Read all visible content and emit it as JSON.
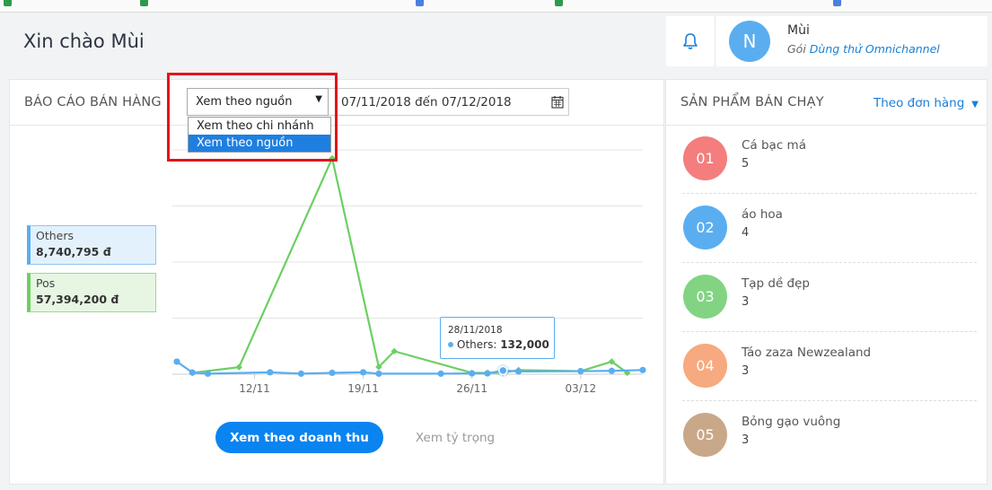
{
  "header": {
    "greeting": "Xin chào Mùi",
    "user_name": "Mùi",
    "plan_prefix": "Gói",
    "plan_name": "Dùng thử Omnichannel",
    "avatar_letter": "N"
  },
  "report": {
    "title": "BÁO CÁO BÁN HÀNG",
    "select_value": "Xem theo nguồn",
    "date_range": "07/11/2018 đến 07/12/2018",
    "dropdown_options": [
      {
        "label": "Xem theo chi nhánh",
        "selected": false
      },
      {
        "label": "Xem theo nguồn",
        "selected": true
      }
    ],
    "legend": [
      {
        "name": "Others",
        "value": "8,740,795 đ",
        "color": "#5aaef0"
      },
      {
        "name": "Pos",
        "value": "57,394,200 đ",
        "color": "#6ccf62"
      }
    ],
    "tooltip": {
      "date": "28/11/2018",
      "series": "Others",
      "value": "132,000"
    },
    "buttons": {
      "revenue": "Xem theo doanh thu",
      "share": "Xem tỷ trọng"
    }
  },
  "chart_data": {
    "type": "line",
    "x_tick_labels": [
      "12/11",
      "19/11",
      "26/11",
      "03/12"
    ],
    "x": [
      "07/11",
      "08/11",
      "09/11",
      "11/11",
      "13/11",
      "15/11",
      "17/11",
      "19/11",
      "20/11",
      "21/11",
      "24/11",
      "26/11",
      "27/11",
      "28/11",
      "29/11",
      "01/12",
      "03/12",
      "05/12",
      "06/12",
      "07/12"
    ],
    "series": [
      {
        "name": "Others",
        "color": "#5aaef0",
        "values": [
          450000,
          60000,
          20000,
          null,
          70000,
          20000,
          50000,
          70000,
          20000,
          null,
          20000,
          30000,
          30000,
          132000,
          100000,
          null,
          110000,
          120000,
          null,
          150000
        ]
      },
      {
        "name": "Pos",
        "color": "#6ccf62",
        "values": [
          null,
          50000,
          null,
          250000,
          null,
          null,
          7700000,
          null,
          260000,
          820000,
          null,
          50000,
          50000,
          50000,
          150000,
          null,
          110000,
          450000,
          50000,
          null
        ]
      }
    ],
    "ylim": [
      0,
      8000000
    ],
    "grid": true
  },
  "best_sellers": {
    "title": "SẢN PHẨM BÁN CHẠY",
    "filter": "Theo đơn hàng",
    "items": [
      {
        "rank": "01",
        "name": "Cá bạc má",
        "qty": "5",
        "color": "#f47d7d"
      },
      {
        "rank": "02",
        "name": "áo hoa",
        "qty": "4",
        "color": "#5aaef0"
      },
      {
        "rank": "03",
        "name": "Tạp dề đẹp",
        "qty": "3",
        "color": "#82d483"
      },
      {
        "rank": "04",
        "name": "Táo zaza Newzealand",
        "qty": "3",
        "color": "#f7a97f"
      },
      {
        "rank": "05",
        "name": "Bỏng gạo vuông",
        "qty": "3",
        "color": "#c9a889"
      }
    ]
  }
}
